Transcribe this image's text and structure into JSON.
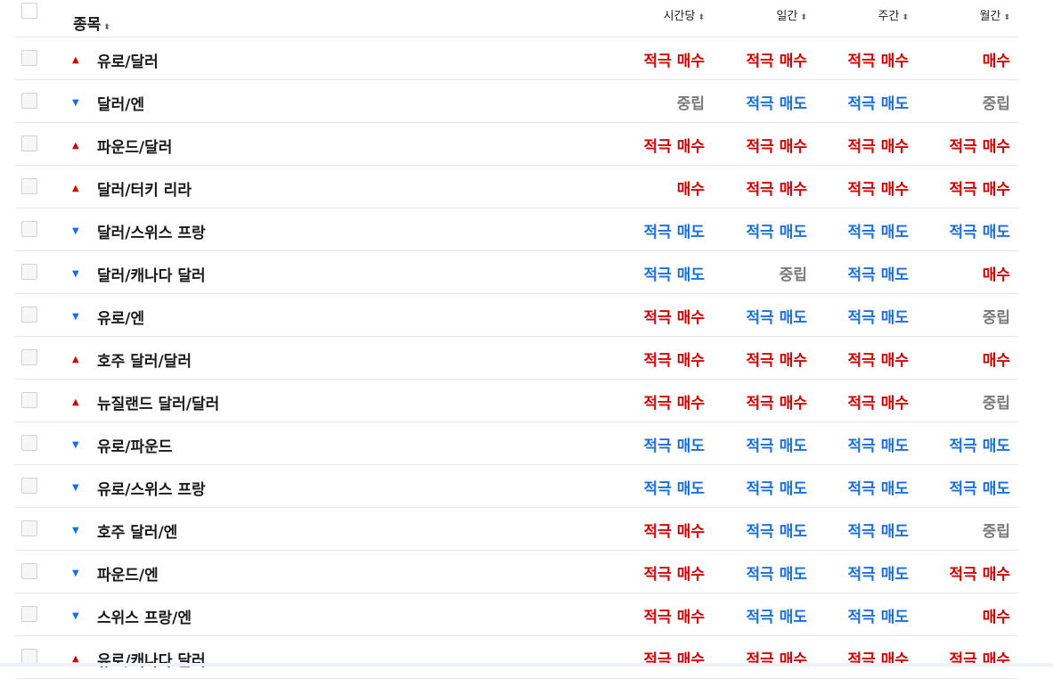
{
  "header": {
    "symbol": "종목",
    "hourly": "시간당",
    "daily": "일간",
    "weekly": "주간",
    "monthly": "월간",
    "sort_glyph": "⬍"
  },
  "colors": {
    "buy": "#d60000",
    "sell": "#1a6fe0",
    "neutral": "#7a7a7a"
  },
  "rows": [
    {
      "name": "유로/달러",
      "dir": "up",
      "hourly": "적극 매수",
      "daily": "적극 매수",
      "weekly": "적극 매수",
      "monthly": "매수"
    },
    {
      "name": "달러/엔",
      "dir": "down",
      "hourly": "중립",
      "daily": "적극 매도",
      "weekly": "적극 매도",
      "monthly": "중립"
    },
    {
      "name": "파운드/달러",
      "dir": "up",
      "hourly": "적극 매수",
      "daily": "적극 매수",
      "weekly": "적극 매수",
      "monthly": "적극 매수"
    },
    {
      "name": "달러/터키 리라",
      "dir": "up",
      "hourly": "매수",
      "daily": "적극 매수",
      "weekly": "적극 매수",
      "monthly": "적극 매수"
    },
    {
      "name": "달러/스위스 프랑",
      "dir": "down",
      "hourly": "적극 매도",
      "daily": "적극 매도",
      "weekly": "적극 매도",
      "monthly": "적극 매도"
    },
    {
      "name": "달러/캐나다 달러",
      "dir": "down",
      "hourly": "적극 매도",
      "daily": "중립",
      "weekly": "적극 매도",
      "monthly": "매수"
    },
    {
      "name": "유로/엔",
      "dir": "down",
      "hourly": "적극 매수",
      "daily": "적극 매도",
      "weekly": "적극 매도",
      "monthly": "중립"
    },
    {
      "name": "호주 달러/달러",
      "dir": "up",
      "hourly": "적극 매수",
      "daily": "적극 매수",
      "weekly": "적극 매수",
      "monthly": "매수"
    },
    {
      "name": "뉴질랜드 달러/달러",
      "dir": "up",
      "hourly": "적극 매수",
      "daily": "적극 매수",
      "weekly": "적극 매수",
      "monthly": "중립"
    },
    {
      "name": "유로/파운드",
      "dir": "down",
      "hourly": "적극 매도",
      "daily": "적극 매도",
      "weekly": "적극 매도",
      "monthly": "적극 매도"
    },
    {
      "name": "유로/스위스 프랑",
      "dir": "down",
      "hourly": "적극 매도",
      "daily": "적극 매도",
      "weekly": "적극 매도",
      "monthly": "적극 매도"
    },
    {
      "name": "호주 달러/엔",
      "dir": "down",
      "hourly": "적극 매수",
      "daily": "적극 매도",
      "weekly": "적극 매도",
      "monthly": "중립"
    },
    {
      "name": "파운드/엔",
      "dir": "down",
      "hourly": "적극 매수",
      "daily": "적극 매도",
      "weekly": "적극 매도",
      "monthly": "적극 매수"
    },
    {
      "name": "스위스 프랑/엔",
      "dir": "down",
      "hourly": "적극 매수",
      "daily": "적극 매도",
      "weekly": "적극 매도",
      "monthly": "매수"
    },
    {
      "name": "유로/캐나다 달러",
      "dir": "up",
      "hourly": "적극 매수",
      "daily": "적극 매수",
      "weekly": "적극 매수",
      "monthly": "적극 매수"
    }
  ]
}
